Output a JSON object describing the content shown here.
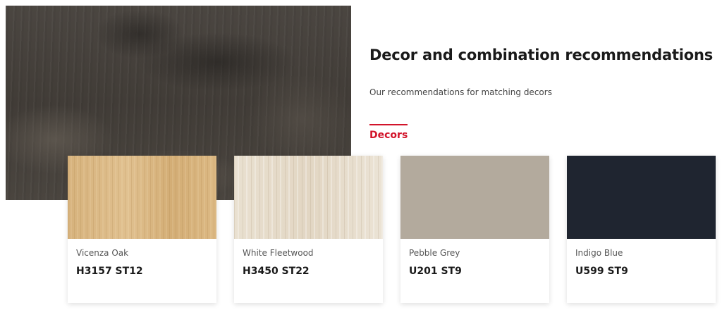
{
  "section": {
    "title": "Decor and combination recommendations",
    "subtitle": "Our recommendations for matching decors",
    "tab_label": "Decors"
  },
  "colors": {
    "accent": "#d2142a",
    "hero_texture": "#48433e"
  },
  "decors": [
    {
      "name": "Vicenza Oak",
      "code": "H3157 ST12",
      "swatch_color": "#d9b783"
    },
    {
      "name": "White Fleetwood",
      "code": "H3450 ST22",
      "swatch_color": "#e6dccb"
    },
    {
      "name": "Pebble Grey",
      "code": "U201 ST9",
      "swatch_color": "#b3aa9d"
    },
    {
      "name": "Indigo Blue",
      "code": "U599 ST9",
      "swatch_color": "#1f2530"
    }
  ]
}
